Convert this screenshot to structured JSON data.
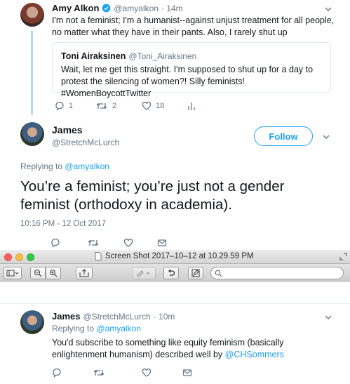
{
  "tweet1": {
    "name": "Amy Alkon",
    "handle": "@amyalkon",
    "time": "· 14m",
    "text": "I'm not a feminist; I'm a humanist--against unjust treatment for all people, no matter what they have in their pants. Also, I rarely shut up",
    "quote": {
      "name": "Toni Airaksinen",
      "handle": "@Toni_Airaksinen",
      "text": "Wait, let me get this straight. I'm supposed to shut up for a day to protest the silencing of women?! Silly feminists! #WomenBoycottTwitter"
    },
    "actions": {
      "replies": "1",
      "retweets": "2",
      "likes": "18"
    }
  },
  "tweet2": {
    "name": "James",
    "handle": "@StretchMcLurch",
    "follow_label": "Follow",
    "replying_prefix": "Replying to",
    "replying_to": "@amyalkon",
    "text": "You’re a feminist; you’re just not a gender feminist (orthodoxy in academia).",
    "timestamp": "10:16 PM - 12 Oct 2017"
  },
  "window": {
    "title": "Screen Shot 2017–10–12 at 10.29.59 PM",
    "search_placeholder": ""
  },
  "tweet3": {
    "name": "James",
    "handle": "@StretchMcLurch",
    "time": "· 10m",
    "replying_prefix": "Replying to",
    "replying_to": "@amyalkon",
    "text": "You'd subscribe to something like equity feminism (basically enlightenment humanism) described well by",
    "mention": "@CHSommers"
  },
  "colors": {
    "link": "#1da1f2",
    "muted": "#657786",
    "verified": "#1da1f2",
    "thread_line": "#a8dbf7"
  }
}
